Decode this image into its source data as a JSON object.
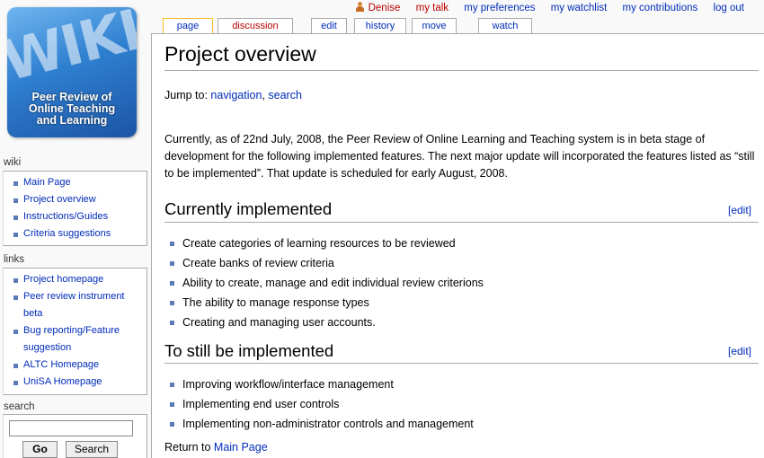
{
  "logo": {
    "word": "WIKI",
    "text_line1": "Peer Review of",
    "text_line2": "Online Teaching",
    "text_line3": "and Learning"
  },
  "personal_tools": {
    "user": "Denise",
    "talk": "my talk",
    "preferences": "my preferences",
    "watchlist": "my watchlist",
    "contributions": "my contributions",
    "logout": "log out"
  },
  "tabs": {
    "page": "page",
    "discussion": "discussion",
    "edit": "edit",
    "history": "history",
    "move": "move",
    "watch": "watch"
  },
  "sidebar": {
    "wiki_title": "wiki",
    "wiki_items": [
      "Main Page",
      "Project overview",
      "Instructions/Guides",
      "Criteria suggestions"
    ],
    "links_title": "links",
    "links_items": [
      "Project homepage",
      "Peer review instrument",
      "beta",
      "Bug reporting/Feature",
      "suggestion",
      "ALTC Homepage",
      "UniSA Homepage"
    ],
    "search_title": "search",
    "search_value": "",
    "go_label": "Go",
    "search_label": "Search"
  },
  "content": {
    "title": "Project overview",
    "jump_prefix": "Jump to:",
    "jump_nav": "navigation",
    "jump_sep": ",",
    "jump_search": "search",
    "intro": "Currently, as of 22nd July, 2008, the Peer Review of Online Learning and Teaching system is in beta stage of development for the following implemented features. The next major update will incorporated the features listed as “still to be implemented”. That update is scheduled for early August, 2008.",
    "section1": {
      "title": "Currently implemented",
      "edit": "[edit]",
      "items": [
        "Create categories of learning resources to be reviewed",
        "Create banks of review criteria",
        "Ability to create, manage and edit individual review criterions",
        "The ability to manage response types",
        "Creating and managing user accounts."
      ]
    },
    "section2": {
      "title": "To still be implemented",
      "edit": "[edit]",
      "items": [
        "Improving workflow/interface management",
        "Implementing end user controls",
        "Implementing non-administrator controls and management"
      ]
    },
    "return_prefix": "Return to",
    "return_link": "Main Page"
  }
}
